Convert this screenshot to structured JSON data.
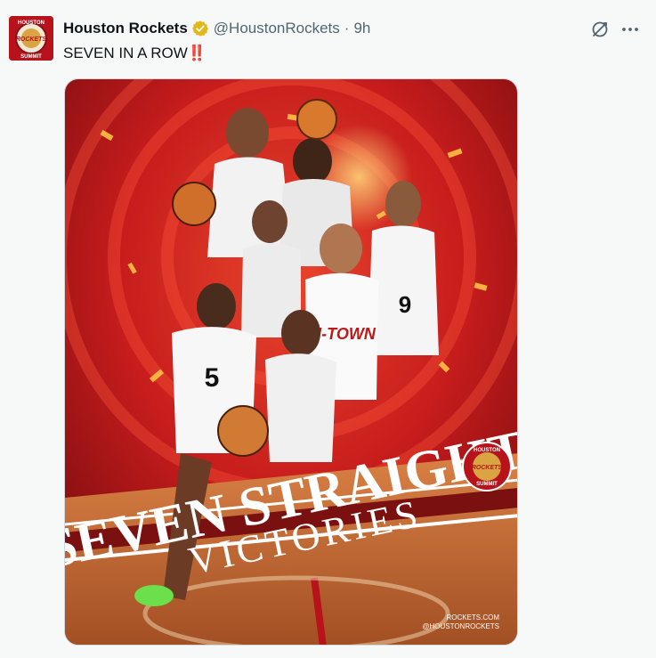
{
  "tweet": {
    "author_name": "Houston Rockets",
    "handle": "@HoustonRockets",
    "separator": "·",
    "time": "9h",
    "text": "SEVEN IN A ROW",
    "emoji": "‼️"
  },
  "avatar": {
    "top_text": "HOUSTON",
    "middle_text": "ROCKETS",
    "bottom_text": "SUMMIT"
  },
  "image": {
    "headline_1": "SEVEN STRAIGHT",
    "headline_2": "VICTORIES",
    "jersey_text": "H-TOWN",
    "badge_top": "HOUSTON",
    "badge_mid": "ROCKETS",
    "badge_bottom": "SUMMIT",
    "credit_1": "ROCKETS.COM",
    "credit_2": "@HOUSTONROCKETS",
    "colors": {
      "bg": "#c81e1e",
      "court": "#c2682e",
      "white": "#ffffff"
    }
  },
  "icons": {
    "verified": "verified-badge-icon",
    "grok": "grok-icon",
    "more": "more-icon"
  }
}
